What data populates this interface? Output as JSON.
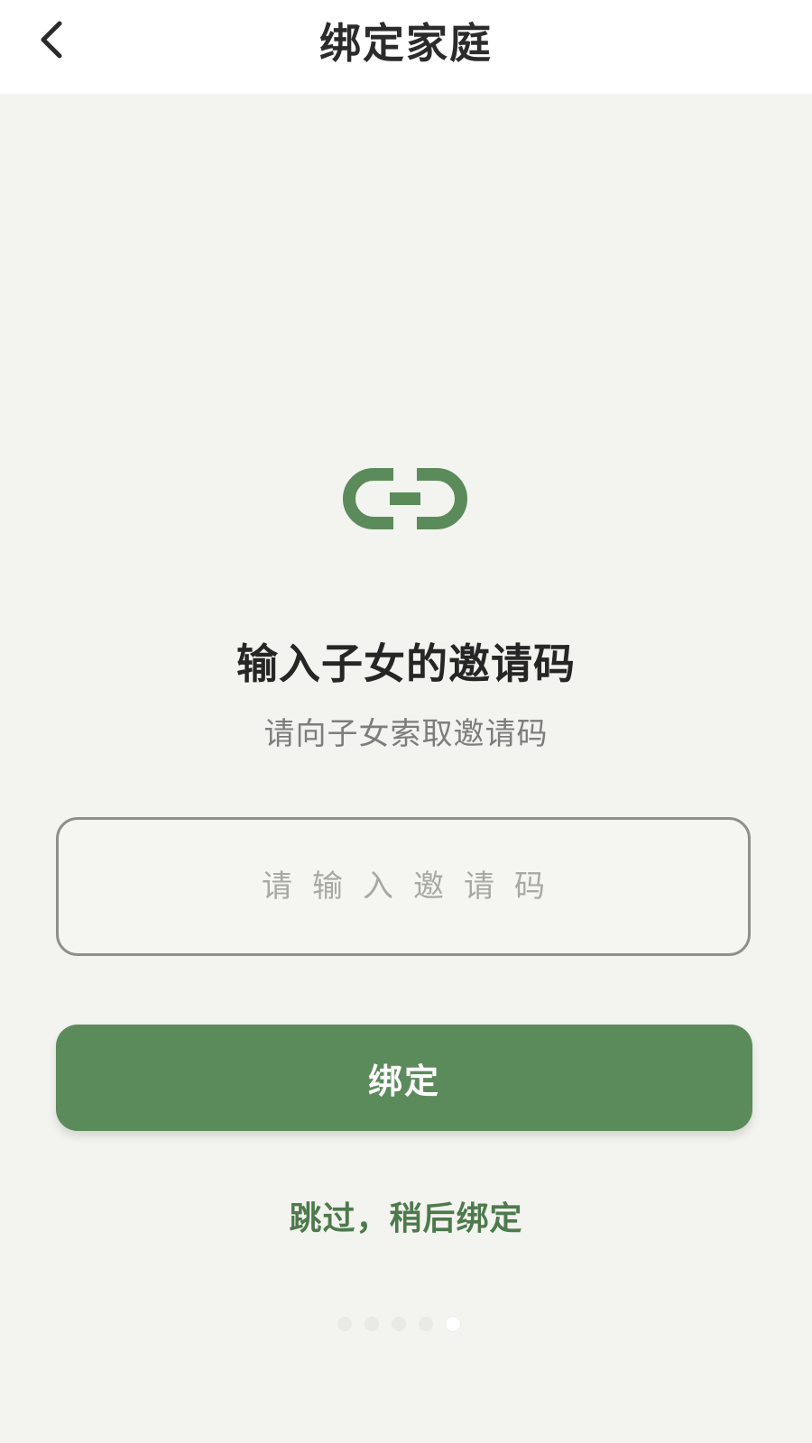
{
  "header": {
    "title": "绑定家庭",
    "back_icon": "chevron-left-icon"
  },
  "main": {
    "icon": "link-icon",
    "accent_color": "#5b8b5a",
    "title": "输入子女的邀请码",
    "subtitle": "请向子女索取邀请码",
    "code_input": {
      "placeholder": "请输入邀请码",
      "value": ""
    },
    "bind_button_label": "绑定",
    "skip_label": "跳过，稍后绑定"
  },
  "pagination": {
    "total": 5,
    "active_index": 4
  }
}
